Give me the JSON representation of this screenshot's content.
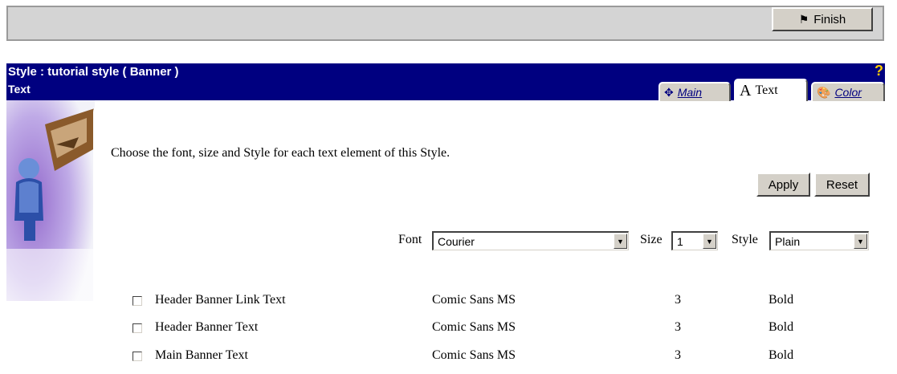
{
  "toolbar": {
    "finish_label": "Finish"
  },
  "header": {
    "title": "Style : tutorial style ( Banner )",
    "subtitle": "Text",
    "help": "?"
  },
  "tabs": [
    {
      "label": "Main",
      "icon": "move-arrows-icon",
      "active": false
    },
    {
      "label": "Text",
      "icon": "letter-a-icon",
      "active": true
    },
    {
      "label": "Color",
      "icon": "palette-icon",
      "active": false
    }
  ],
  "intro": "Choose the font, size and Style for each text element of this Style.",
  "actions": {
    "apply_label": "Apply",
    "reset_label": "Reset"
  },
  "controls": {
    "font_label": "Font",
    "font_value": "Courier",
    "size_label": "Size",
    "size_value": "1",
    "style_label": "Style",
    "style_value": "Plain"
  },
  "rows": [
    {
      "name": "Header Banner Link Text",
      "font": "Comic Sans MS",
      "size": "3",
      "style": "Bold",
      "checked": false
    },
    {
      "name": "Header Banner Text",
      "font": "Comic Sans MS",
      "size": "3",
      "style": "Bold",
      "checked": false
    },
    {
      "name": "Main Banner Text",
      "font": "Comic Sans MS",
      "size": "3",
      "style": "Bold",
      "checked": false
    }
  ],
  "colors": {
    "header_bg": "#000080",
    "help_accent": "#ffcc00"
  }
}
